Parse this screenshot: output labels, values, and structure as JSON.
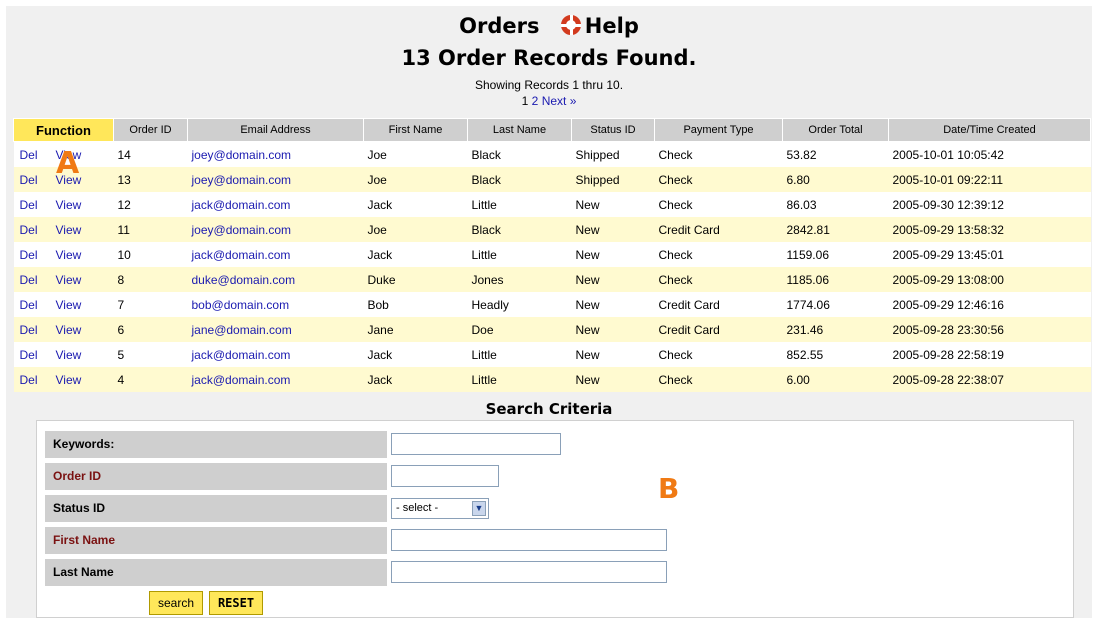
{
  "header": {
    "title": "Orders",
    "help_label": "Help",
    "records_found": "13 Order Records Found.",
    "showing": "Showing Records 1 thru 10.",
    "pager": {
      "current": "1",
      "page2": "2",
      "next": "Next »"
    }
  },
  "table": {
    "columns": [
      "Function",
      "Order ID",
      "Email Address",
      "First Name",
      "Last Name",
      "Status ID",
      "Payment Type",
      "Order Total",
      "Date/Time Created"
    ],
    "action_del": "Del",
    "action_view": "View",
    "rows": [
      {
        "id": "14",
        "email": "joey@domain.com",
        "first": "Joe",
        "last": "Black",
        "status": "Shipped",
        "payment": "Check",
        "total": "53.82",
        "created": "2005-10-01 10:05:42"
      },
      {
        "id": "13",
        "email": "joey@domain.com",
        "first": "Joe",
        "last": "Black",
        "status": "Shipped",
        "payment": "Check",
        "total": "6.80",
        "created": "2005-10-01 09:22:11"
      },
      {
        "id": "12",
        "email": "jack@domain.com",
        "first": "Jack",
        "last": "Little",
        "status": "New",
        "payment": "Check",
        "total": "86.03",
        "created": "2005-09-30 12:39:12"
      },
      {
        "id": "11",
        "email": "joey@domain.com",
        "first": "Joe",
        "last": "Black",
        "status": "New",
        "payment": "Credit Card",
        "total": "2842.81",
        "created": "2005-09-29 13:58:32"
      },
      {
        "id": "10",
        "email": "jack@domain.com",
        "first": "Jack",
        "last": "Little",
        "status": "New",
        "payment": "Check",
        "total": "1159.06",
        "created": "2005-09-29 13:45:01"
      },
      {
        "id": "8",
        "email": "duke@domain.com",
        "first": "Duke",
        "last": "Jones",
        "status": "New",
        "payment": "Check",
        "total": "1185.06",
        "created": "2005-09-29 13:08:00"
      },
      {
        "id": "7",
        "email": "bob@domain.com",
        "first": "Bob",
        "last": "Headly",
        "status": "New",
        "payment": "Credit Card",
        "total": "1774.06",
        "created": "2005-09-29 12:46:16"
      },
      {
        "id": "6",
        "email": "jane@domain.com",
        "first": "Jane",
        "last": "Doe",
        "status": "New",
        "payment": "Credit Card",
        "total": "231.46",
        "created": "2005-09-28 23:30:56"
      },
      {
        "id": "5",
        "email": "jack@domain.com",
        "first": "Jack",
        "last": "Little",
        "status": "New",
        "payment": "Check",
        "total": "852.55",
        "created": "2005-09-28 22:58:19"
      },
      {
        "id": "4",
        "email": "jack@domain.com",
        "first": "Jack",
        "last": "Little",
        "status": "New",
        "payment": "Check",
        "total": "6.00",
        "created": "2005-09-28 22:38:07"
      }
    ]
  },
  "markers": {
    "a": "A",
    "b": "B"
  },
  "search": {
    "title": "Search Criteria",
    "keywords_label": "Keywords:",
    "order_id_label": "Order ID",
    "status_id_label": "Status ID",
    "status_selected": "- select -",
    "first_name_label": "First Name",
    "last_name_label": "Last Name",
    "search_button": "search",
    "reset_button": "RESET"
  },
  "colors": {
    "accent": "#ffe75a",
    "link": "#1a1ab0",
    "marker": "#f07a14",
    "required_label": "#7a1111"
  }
}
